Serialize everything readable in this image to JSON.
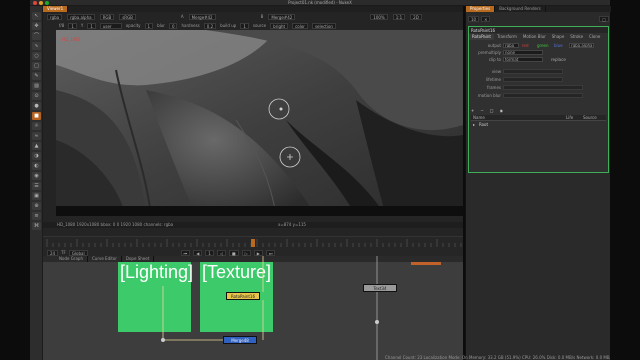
{
  "window": {
    "title": "Project01.nk (modified) - NukeX"
  },
  "viewer": {
    "tab_label": "Viewer1",
    "row1": {
      "layer": "rgba",
      "channel": "rgba.alpha",
      "colorspace": "RGB",
      "lut": "sRGB",
      "input_a": "A",
      "input_a_node": "Merge#42",
      "input_b": "B",
      "input_b_node": "Merge#42",
      "zoom": "100%",
      "ratio": "1:1",
      "mode": "2D"
    },
    "row2": {
      "fstop_label": "f/8",
      "frame_label": "1",
      "y_label": "Y",
      "y_value": "1",
      "gain_label": "user",
      "opacity_label": "opacity",
      "opacity_value": "1",
      "blur_label": "blur",
      "blur_value": "0",
      "hardness_label": "hardness",
      "hardness_value": "0.2",
      "build_label": "build up",
      "build_value": "1",
      "source": "source",
      "source_value": "bright",
      "dirname": "color",
      "selection_label": "selection"
    },
    "info_left": "HD_1080 1920x1080  bbox: 0 0 1920 1080 channels: rgba",
    "info_right": "x=874 y=115",
    "resolution_label": "HD_1080"
  },
  "timeline": {
    "fps_label": "fps",
    "fps_value": "24",
    "tf_label": "TF",
    "global_label": "Global",
    "frame_value": "1"
  },
  "node_graph": {
    "tabs": [
      "Node Graph",
      "Curve Editor",
      "Dope Sheet"
    ],
    "backdrops": [
      {
        "title": "[Lighting]"
      },
      {
        "title": "[Texture]"
      }
    ],
    "nodes": [
      {
        "label": "RotoPaint16",
        "color": "#e8c44a"
      },
      {
        "label": "Text34",
        "color": "#9a9a9a"
      },
      {
        "label": "Merge48",
        "color": "#3060c0"
      }
    ]
  },
  "properties": {
    "tabs": [
      "Properties",
      "Background Renders"
    ],
    "node_name": "RotoPaint16",
    "subtabs": [
      "RotoPaint",
      "Transform",
      "Motion Blur",
      "Shape",
      "Stroke",
      "Clone"
    ],
    "output_label": "output",
    "output_value": "rgba",
    "channels": [
      "red",
      "green",
      "blue",
      "rgba.alpha"
    ],
    "premult_label": "premultiply",
    "premult_value": "none",
    "clip_label": "clip to",
    "clip_value": "format",
    "replace_label": "replace",
    "view_label": "view",
    "lifetime_label": "lifetime",
    "frames_label": "frames",
    "motion_label": "motion blur",
    "list_columns": [
      "Name",
      "Life",
      "Source"
    ],
    "list_items": [
      {
        "name": "Root"
      }
    ]
  },
  "status": {
    "text": "Channel Count: 23  Localization Mode: On  Memory: 33.2 GB (51.9%)  CPU: 26.0%  Disk: 0.0 MB/s  Network: 0.0 MB/s"
  },
  "colors": {
    "accent": "#b86a1f",
    "backdrop": "#3dca6a",
    "selection": "#3fae5a"
  }
}
